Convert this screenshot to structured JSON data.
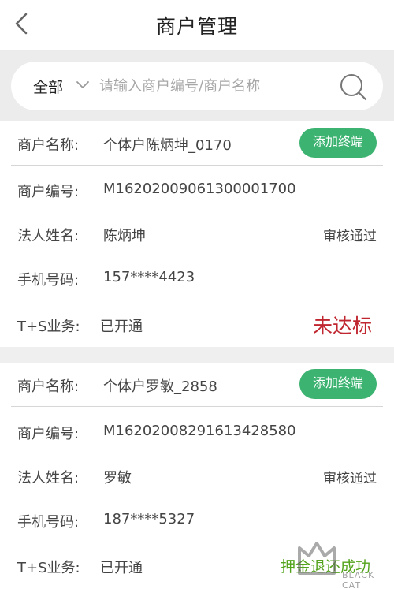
{
  "header": {
    "title": "商户管理"
  },
  "search": {
    "filter_label": "全部",
    "placeholder": "请输入商户编号/商户名称"
  },
  "merchants": [
    {
      "name_label": "商户名称:",
      "name": "个体户陈炳坤_0170",
      "button": "添加终端",
      "id_label": "商户编号:",
      "id": "M16202009061300001700",
      "legal_label": "法人姓名:",
      "legal": "陈炳坤",
      "audit": "审核通过",
      "phone_label": "手机号码:",
      "phone": "157****4423",
      "ts_label": "T+S业务:",
      "ts": "已开通",
      "flag": "未达标"
    },
    {
      "name_label": "商户名称:",
      "name": "个体户罗敏_2858",
      "button": "添加终端",
      "id_label": "商户编号:",
      "id": "M16202008291613428580",
      "legal_label": "法人姓名:",
      "legal": "罗敏",
      "audit": "审核通过",
      "phone_label": "手机号码:",
      "phone": "187****5327",
      "ts_label": "T+S业务:",
      "ts": "已开通",
      "flag": "押金退还成功"
    }
  ],
  "watermark": {
    "text": "BLACK CAT"
  },
  "colors": {
    "button": "#3cb371",
    "flag_red": "#c0262f",
    "flag_green": "#53a41c"
  }
}
